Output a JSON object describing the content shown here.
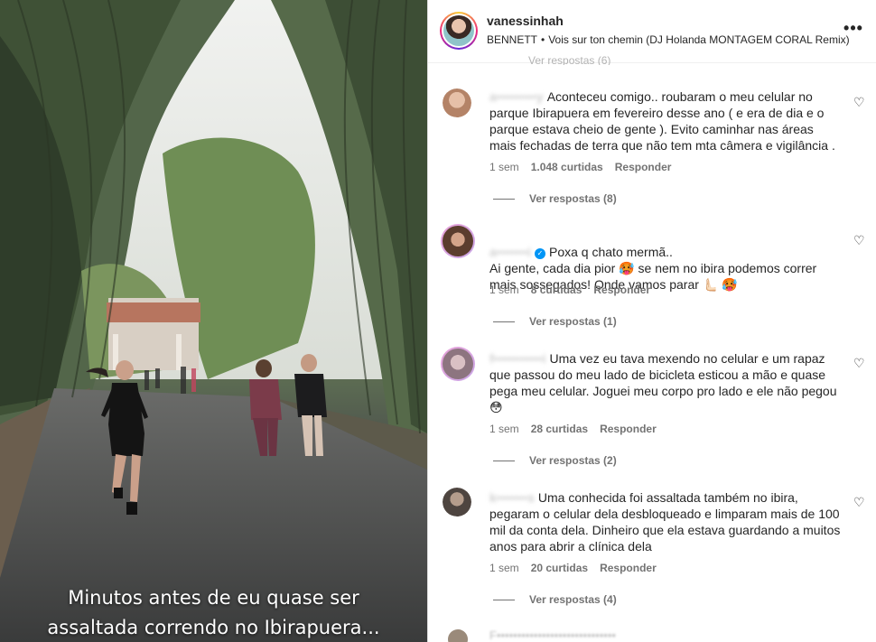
{
  "media": {
    "caption_line1": "Minutos antes de eu quase ser",
    "caption_line2": "assaltada correndo no Ibirapuera..."
  },
  "header": {
    "username": "vanessinhah",
    "song_artist": "BENNETT",
    "song_separator": "•",
    "song_title": "Vois sur ton chemin (DJ Holanda MONTAGEM CORAL Remix)",
    "more_icon": "more-horizontal-icon",
    "more_label": "•••"
  },
  "comments": [
    {
      "username": "a•••••••••y",
      "text": "Aconteceu comigo.. roubaram o meu celular no parque Ibirapuera em fevereiro desse ano ( e era de dia e o parque estava cheio de gente ). Evito caminhar nas áreas mais fechadas de terra que não tem mta câmera e vigilância .",
      "time": "1 sem",
      "likes": "1.048 curtidas",
      "reply_label": "Responder",
      "view_replies": "Ver respostas (8)",
      "avatar_color": "#c9a58f"
    },
    {
      "username": "a•••••••i",
      "verified": true,
      "text": "Poxa q chato mermã..\nAi gente, cada dia pior 🥵  se nem no ibira podemos correr mais sossegados! Onde vamos parar 🫷🏻 🥵",
      "time": "1 sem",
      "likes": "8 curtidas",
      "reply_label": "Responder",
      "view_replies": "Ver respostas (1)",
      "avatar_color": "#8a6a55"
    },
    {
      "username": "f•••••••••••i",
      "text": "Uma vez eu tava mexendo no celular e um rapaz que passou do meu lado de bicicleta esticou a mão e quase pega meu celular. Joguei meu corpo pro lado e ele não pegou 😳",
      "time": "1 sem",
      "likes": "28 curtidas",
      "reply_label": "Responder",
      "view_replies": "Ver respostas (2)",
      "avatar_color": "#b6a2a8"
    },
    {
      "username": "k•••••••s",
      "text": "Uma conhecida foi assaltada também no ibira, pegaram o celular dela desbloqueado e limparam mais de 100 mil da conta dela. Dinheiro que ela estava guardando a muitos anos para abrir a clínica dela",
      "time": "1 sem",
      "likes": "20 curtidas",
      "reply_label": "Responder",
      "view_replies": "Ver respostas (4)",
      "avatar_color": "#7f756e"
    }
  ],
  "partial_top_text": "Ver respostas (6)",
  "partial_bottom_text": "F•••••••••••••••••••••••••••••",
  "colors": {
    "text": "#262626",
    "secondary": "#737373",
    "verified": "#0095f6",
    "border": "#dbdbdb"
  },
  "icons": {
    "heart": "heart-outline-icon",
    "verified": "verified-badge-icon"
  }
}
